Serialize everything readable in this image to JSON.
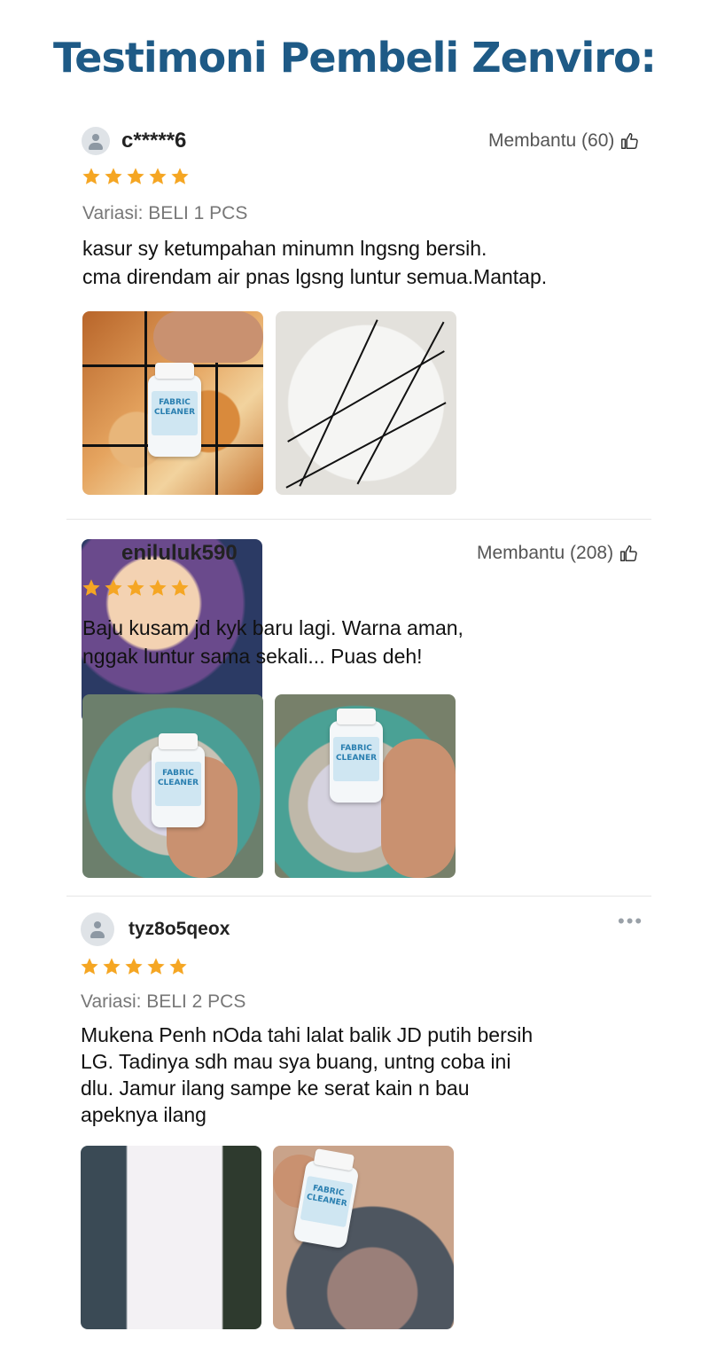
{
  "page": {
    "title": "Testimoni Pembeli Zenviro:"
  },
  "reviews": [
    {
      "username": "c*****6",
      "helpful_label": "Membantu (60)",
      "rating": 5,
      "variant": "Variasi: BELI 1 PCS",
      "text": "kasur sy ketumpahan minumn lngsng bersih.\ncma direndam air pnas lgsng luntur semua.Mantap.",
      "product_label": "FABRIC CLEANER"
    },
    {
      "username": "eniluluk590",
      "helpful_label": "Membantu (208)",
      "rating": 5,
      "text": "Baju kusam jd kyk baru lagi. Warna aman,\nnggak luntur sama sekali... Puas deh!",
      "product_label": "FABRIC CLEANER"
    },
    {
      "username": "tyz8o5qeox",
      "rating": 5,
      "variant": "Variasi: BELI 2 PCS",
      "text": "Mukena Penh nOda tahi lalat balik JD putih bersih\nLG. Tadinya sdh mau sya buang, untng coba ini\ndlu. Jamur ilang sampe ke serat kain n bau\napeknya ilang",
      "product_label": "FABRIC CLEANER"
    }
  ],
  "colors": {
    "title": "#1e5a86",
    "star": "#f5a623"
  },
  "icons": [
    "user-icon",
    "thumbs-up-icon",
    "star-icon",
    "more-icon"
  ]
}
